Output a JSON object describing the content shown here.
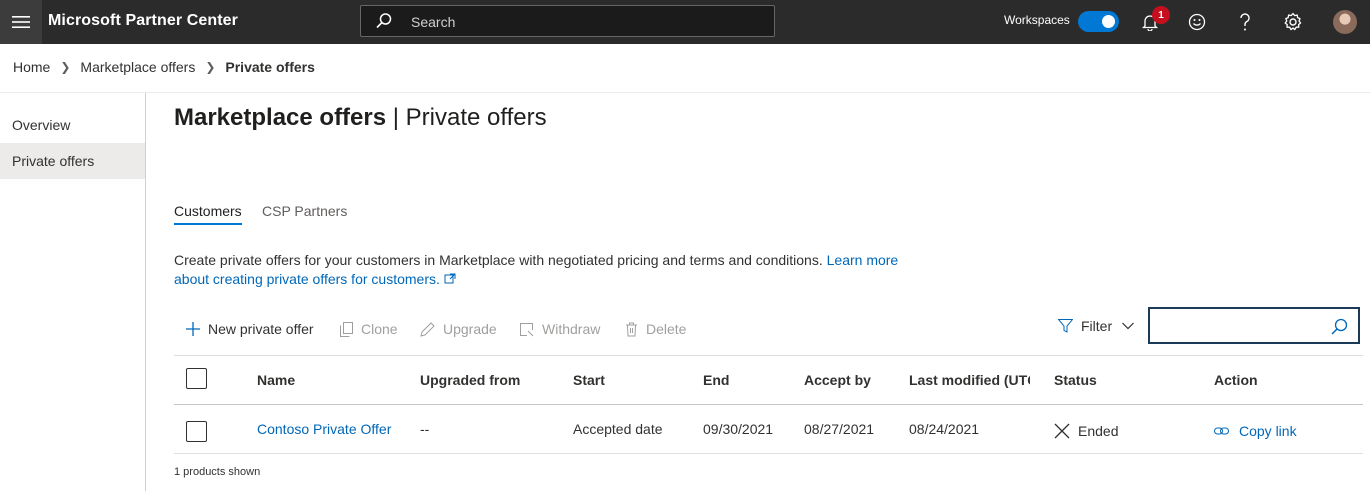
{
  "topbar": {
    "menu_icon": "hamburger-menu-icon",
    "app_title": "Microsoft Partner Center",
    "search_label": "Search",
    "workspaces_label": "Workspaces",
    "workspaces_on": true,
    "notification_count": "1",
    "icons": [
      "bell-icon",
      "smiley-feedback-icon",
      "help-icon",
      "gear-icon",
      "avatar"
    ],
    "accent_color": "#0078d4",
    "badge_color": "#c50f1f"
  },
  "breadcrumb": {
    "items": [
      "Home",
      "Marketplace offers"
    ],
    "current": "Private offers"
  },
  "leftnav": {
    "items": [
      {
        "label": "Overview",
        "selected": false
      },
      {
        "label": "Private offers",
        "selected": true
      }
    ]
  },
  "main": {
    "title_bold": "Marketplace offers",
    "title_rest": " | Private offers",
    "tabs": [
      {
        "label": "Customers",
        "active": true
      },
      {
        "label": "CSP Partners",
        "active": false
      }
    ],
    "description": "Create private offers for your customers in Marketplace with negotiated pricing and terms and conditions. ",
    "learn_more_line1": "Learn more",
    "learn_more_line2": "about creating private offers for customers.",
    "commands": [
      {
        "label": "New private offer",
        "icon": "plus-icon",
        "enabled": true
      },
      {
        "label": "Clone",
        "icon": "copy-icon",
        "enabled": false
      },
      {
        "label": "Upgrade",
        "icon": "edit-icon",
        "enabled": false
      },
      {
        "label": "Withdraw",
        "icon": "withdraw-icon",
        "enabled": false
      },
      {
        "label": "Delete",
        "icon": "trash-icon",
        "enabled": false
      }
    ],
    "filter_label": "Filter",
    "filter_value": ""
  },
  "table": {
    "headers": [
      "Name",
      "Upgraded from",
      "Start",
      "End",
      "Accept by",
      "Last modified (UTC",
      "Status",
      "Action"
    ],
    "rows": [
      {
        "name": "Contoso Private Offer",
        "upgraded_from": "--",
        "start": "Accepted date",
        "end": "09/30/2021",
        "accept_by": "08/27/2021",
        "last_modified": "08/24/2021",
        "status": "Ended",
        "status_icon": "x-ended-icon",
        "action": "Copy link",
        "action_icon": "link-icon"
      }
    ],
    "footer": "1 products shown"
  }
}
